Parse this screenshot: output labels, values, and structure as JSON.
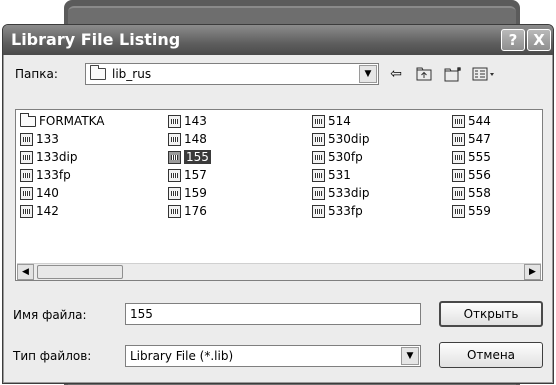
{
  "dialog": {
    "title": "Library File Listing",
    "help_icon": "?",
    "close_icon": "X"
  },
  "folder_bar": {
    "label": "Папка:",
    "current_folder": "lib_rus",
    "icons": [
      "back-arrow-icon",
      "up-folder-icon",
      "new-folder-icon",
      "view-menu-icon"
    ]
  },
  "files": {
    "columns": [
      [
        {
          "name": "FORMATKA",
          "type": "folder"
        },
        {
          "name": "133",
          "type": "file"
        },
        {
          "name": "133dip",
          "type": "file"
        },
        {
          "name": "133fp",
          "type": "file"
        },
        {
          "name": "140",
          "type": "file"
        },
        {
          "name": "142",
          "type": "file"
        }
      ],
      [
        {
          "name": "143",
          "type": "file"
        },
        {
          "name": "148",
          "type": "file"
        },
        {
          "name": "155",
          "type": "file",
          "selected": true
        },
        {
          "name": "157",
          "type": "file"
        },
        {
          "name": "159",
          "type": "file"
        },
        {
          "name": "176",
          "type": "file"
        }
      ],
      [
        {
          "name": "514",
          "type": "file"
        },
        {
          "name": "530dip",
          "type": "file"
        },
        {
          "name": "530fp",
          "type": "file"
        },
        {
          "name": "531",
          "type": "file"
        },
        {
          "name": "533dip",
          "type": "file"
        },
        {
          "name": "533fp",
          "type": "file"
        }
      ],
      [
        {
          "name": "544",
          "type": "file"
        },
        {
          "name": "547",
          "type": "file"
        },
        {
          "name": "555",
          "type": "file"
        },
        {
          "name": "556",
          "type": "file"
        },
        {
          "name": "558",
          "type": "file"
        },
        {
          "name": "559",
          "type": "file"
        }
      ]
    ]
  },
  "filename": {
    "label": "Имя файла:",
    "value": "155"
  },
  "filetype": {
    "label": "Тип файлов:",
    "selected": "Library File (*.lib)"
  },
  "buttons": {
    "open": "Открыть",
    "cancel": "Отмена"
  }
}
